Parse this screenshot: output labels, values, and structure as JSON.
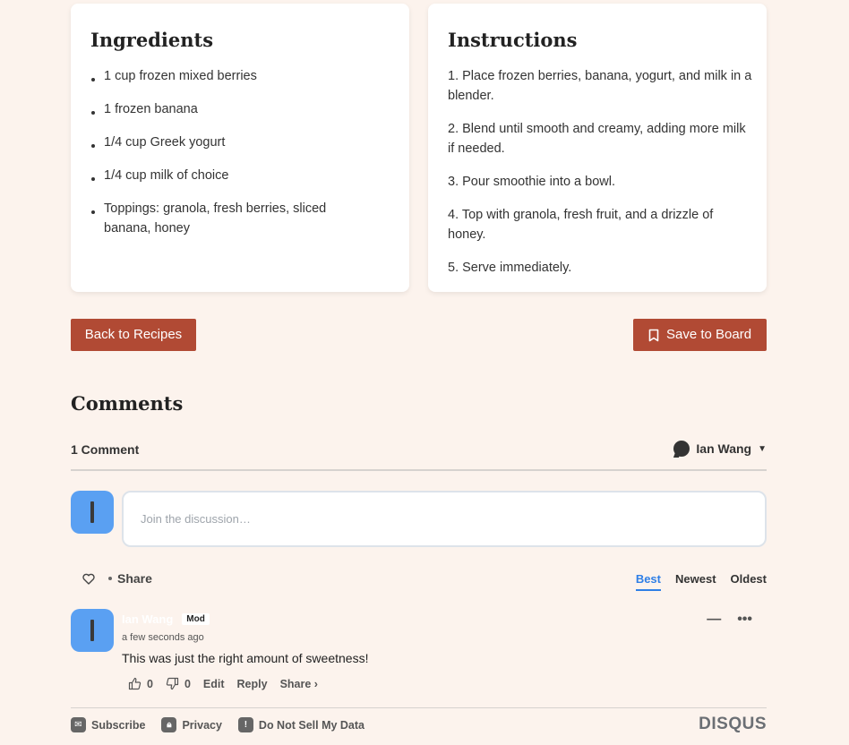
{
  "ingredients": {
    "title": "Ingredients",
    "items": [
      "1 cup frozen mixed berries",
      "1 frozen banana",
      "1/4 cup Greek yogurt",
      "1/4 cup milk of choice",
      "Toppings: granola, fresh berries, sliced banana, honey"
    ]
  },
  "instructions": {
    "title": "Instructions",
    "steps": [
      "1. Place frozen berries, banana, yogurt, and milk in a blender.",
      "2. Blend until smooth and creamy, adding more milk if needed.",
      "3. Pour smoothie into a bowl.",
      "4. Top with granola, fresh fruit, and a drizzle of honey.",
      "5. Serve immediately."
    ]
  },
  "actions": {
    "back_label": "Back to Recipes",
    "save_label": "Save to Board",
    "accent": "#b14a34"
  },
  "comments": {
    "title": "Comments",
    "count_label": "1 Comment",
    "user_name": "Ian Wang",
    "input_placeholder": "Join the discussion…",
    "share_label": "Share",
    "sort": {
      "best": "Best",
      "newest": "Newest",
      "oldest": "Oldest"
    },
    "item": {
      "author": "Ian Wang",
      "badge": "Mod",
      "time": "a few seconds ago",
      "text": "This was just the right amount of sweetness!",
      "upvotes": "0",
      "downvotes": "0",
      "edit": "Edit",
      "reply": "Reply",
      "share": "Share ›",
      "collapse": "—",
      "more": "•••"
    },
    "avatar_color": "#5aa0f2",
    "active_sort_color": "#2f7fe6"
  },
  "footer": {
    "subscribe": "Subscribe",
    "privacy": "Privacy",
    "do_not_sell": "Do Not Sell My Data",
    "brand": "DISQUS"
  }
}
